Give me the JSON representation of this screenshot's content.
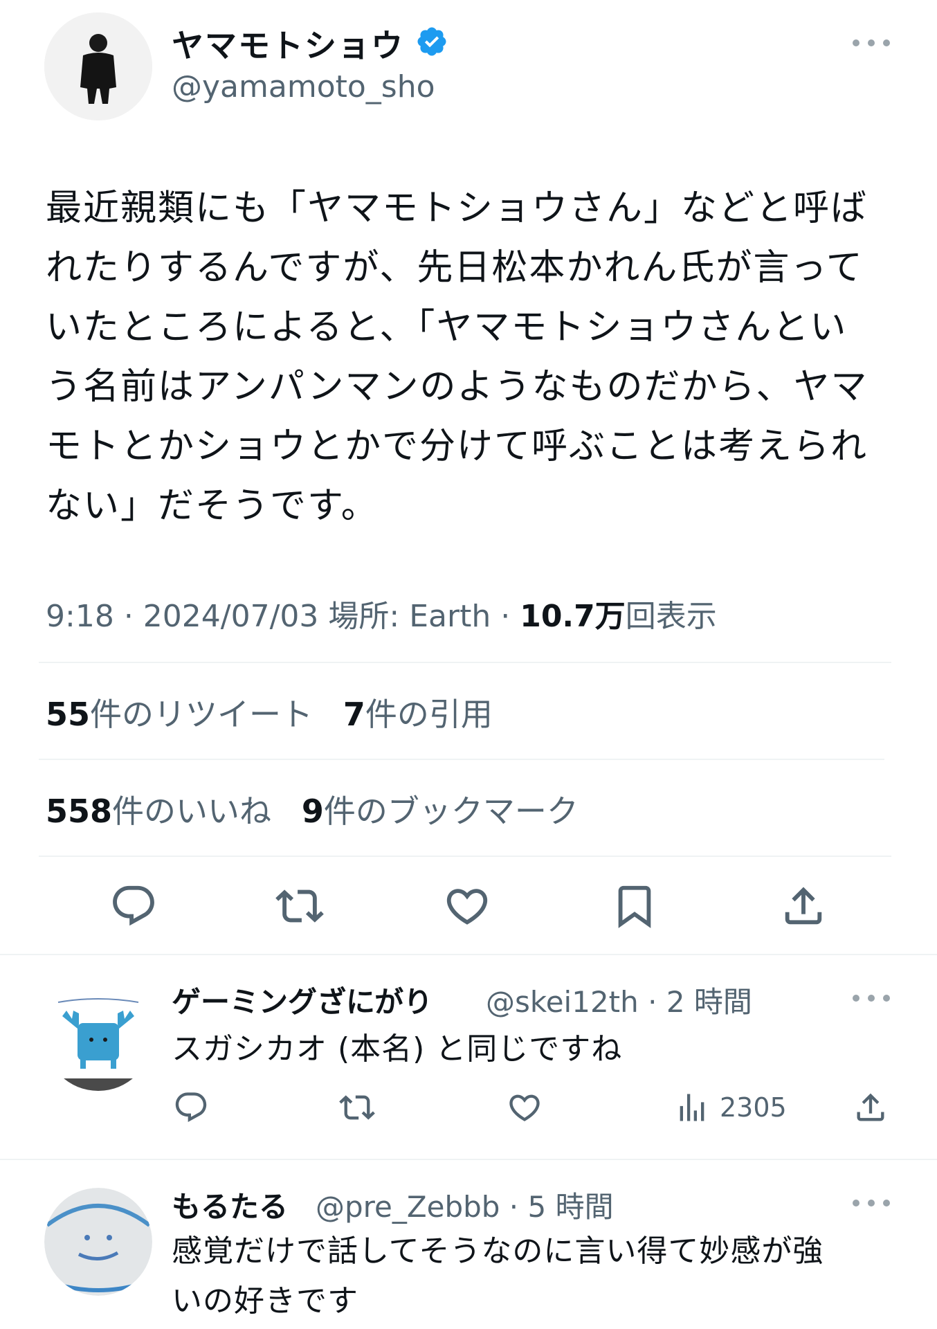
{
  "main_tweet": {
    "display_name": "ヤマモトショウ",
    "handle": "@yamamoto_sho",
    "text_lines": [
      "最近親類にも「ヤマモトショウさん」などと呼ば",
      "れたりするんですが、先日松本かれん氏が言って",
      "いたところによると、「ヤマモトショウさんとい",
      "う名前はアンパンマンのようなものだから、ヤマ",
      "モトとかショウとかで分けて呼ぶことは考えられ",
      "ない」だそうです。"
    ],
    "time": "9:18",
    "date": "2024/07/03",
    "location": "場所: Earth",
    "views_count": "10.7万",
    "views_label": "回表示",
    "retweets_count": "55",
    "retweets_label": "件のリツイート",
    "quotes_count": "7",
    "quotes_label": "件の引用",
    "likes_count": "558",
    "likes_label": "件のいいね",
    "bookmarks_count": "9",
    "bookmarks_label": "件のブックマーク",
    "separator": "·"
  },
  "replies": [
    {
      "display_name": "ゲーミングざにがり",
      "handle": "@skei12th",
      "time": "2 時間",
      "text_lines": [
        "スガシカオ (本名) と同じですね"
      ],
      "views": "2305"
    },
    {
      "display_name": "もるたる",
      "handle": "@pre_Zebbb",
      "time": "5 時間",
      "text_lines": [
        "感覚だけで話してそうなのに言い得て妙感が強",
        "いの好きです"
      ]
    }
  ],
  "icons": {
    "verified": "verified-badge-icon",
    "reply": "reply-icon",
    "retweet": "retweet-icon",
    "like": "heart-icon",
    "bookmark": "bookmark-icon",
    "share": "share-icon",
    "views": "views-chart-icon",
    "more": "more-dots-icon"
  },
  "colors": {
    "verified_blue": "#1d9bf0",
    "text_primary": "#0f1419",
    "text_secondary": "#536471",
    "icon_grey": "#536471",
    "divider": "#eff3f4"
  }
}
